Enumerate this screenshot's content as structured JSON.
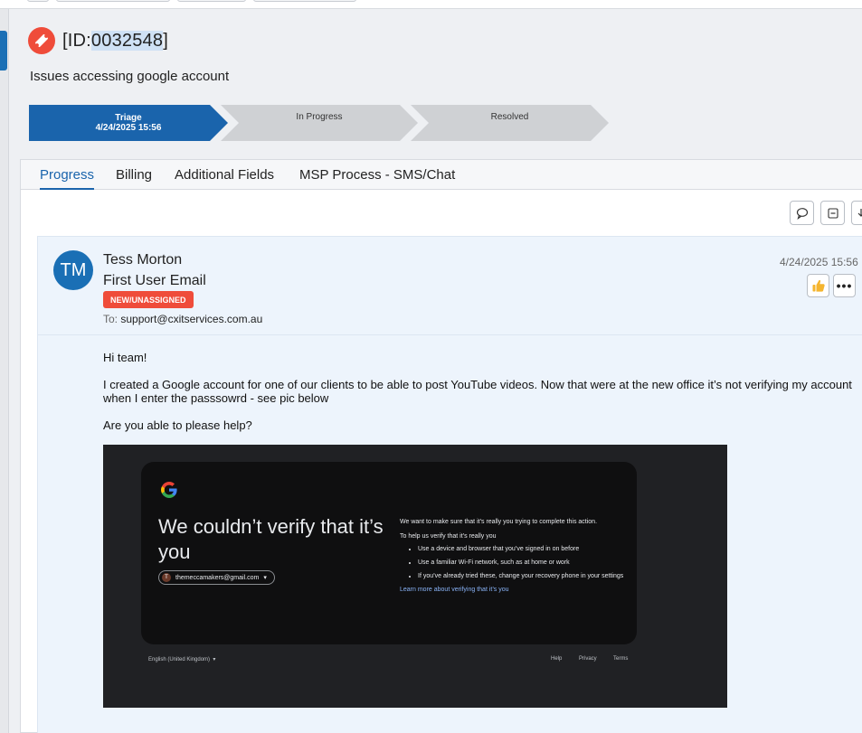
{
  "ticket": {
    "id_prefix": "[ID:",
    "id_number": "0032548",
    "id_suffix": "]",
    "subject": "Issues accessing google account"
  },
  "stages": [
    {
      "label": "Triage",
      "date": "4/24/2025 15:56"
    },
    {
      "label": "In Progress"
    },
    {
      "label": "Resolved"
    }
  ],
  "tabs": [
    "Progress",
    "Billing",
    "Additional Fields",
    "MSP Process - SMS/Chat"
  ],
  "email": {
    "avatar_initials": "TM",
    "sender": "Tess Morton",
    "title": "First User Email",
    "status": "NEW/UNASSIGNED",
    "to_label": "To:",
    "to_address": "support@cxitservices.com.au",
    "date": "4/24/2025 15:56",
    "more_label": "•••",
    "body": {
      "greeting": "Hi team!",
      "paragraph": " I created a Google account for one of our clients to be able to post YouTube videos. Now that were at the new office it’s not verifying my account when I enter the passsowrd - see pic below",
      "question": "Are you able to please help?"
    }
  },
  "screenshot": {
    "heading": "We couldn’t verify that it’s you",
    "account_initial": "T",
    "account_email": "themeccamakers@gmail.com",
    "intro": "We want to make sure that it’s really you trying to complete this action.",
    "help_label": "To help us verify that it’s really you",
    "bullets": [
      "Use a device and browser that you’ve signed in on before",
      "Use a familiar Wi-Fi network, such as at home or work",
      "If you’ve already tried these, change your recovery phone in your settings"
    ],
    "link": "Learn more about verifying that it’s you",
    "footer_language": "English (United Kingdom)",
    "footer_links": [
      "Help",
      "Privacy",
      "Terms"
    ]
  },
  "colors": {
    "accent": "#1a64ac",
    "badge_red": "#ef4c3a",
    "card_bg": "#edf4fc",
    "stage_inactive": "#cfd1d4"
  }
}
